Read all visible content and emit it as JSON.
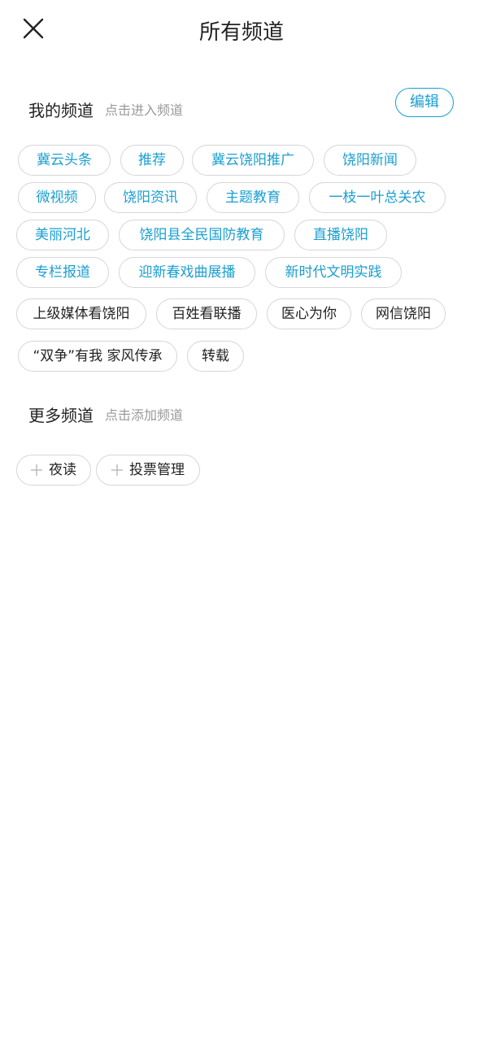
{
  "header": {
    "title": "所有频道",
    "close_icon": "close-icon"
  },
  "my_channels": {
    "title": "我的频道",
    "hint": "点击进入频道",
    "edit_label": "编辑",
    "accent_color": "#1a9fd0",
    "items": [
      {
        "label": "冀云头条",
        "style": "blue"
      },
      {
        "label": "推荐",
        "style": "blue"
      },
      {
        "label": "冀云饶阳推广",
        "style": "blue"
      },
      {
        "label": "饶阳新闻",
        "style": "blue"
      },
      {
        "label": "微视频",
        "style": "blue"
      },
      {
        "label": "饶阳资讯",
        "style": "blue"
      },
      {
        "label": "主题教育",
        "style": "blue"
      },
      {
        "label": "一枝一叶总关农",
        "style": "blue"
      },
      {
        "label": "美丽河北",
        "style": "blue"
      },
      {
        "label": "饶阳县全民国防教育",
        "style": "blue"
      },
      {
        "label": "直播饶阳",
        "style": "blue"
      },
      {
        "label": "专栏报道",
        "style": "blue"
      },
      {
        "label": "迎新春戏曲展播",
        "style": "blue"
      },
      {
        "label": "新时代文明实践",
        "style": "blue"
      },
      {
        "label": "上级媒体看饶阳",
        "style": "dark"
      },
      {
        "label": "百姓看联播",
        "style": "dark"
      },
      {
        "label": "医心为你",
        "style": "dark"
      },
      {
        "label": "网信饶阳",
        "style": "dark"
      },
      {
        "label": "“双争”有我 家风传承",
        "style": "dark"
      },
      {
        "label": "转载",
        "style": "dark"
      }
    ]
  },
  "more_channels": {
    "title": "更多频道",
    "hint": "点击添加频道",
    "add_icon": "plus-icon",
    "items": [
      {
        "label": "夜读"
      },
      {
        "label": "投票管理"
      }
    ]
  }
}
